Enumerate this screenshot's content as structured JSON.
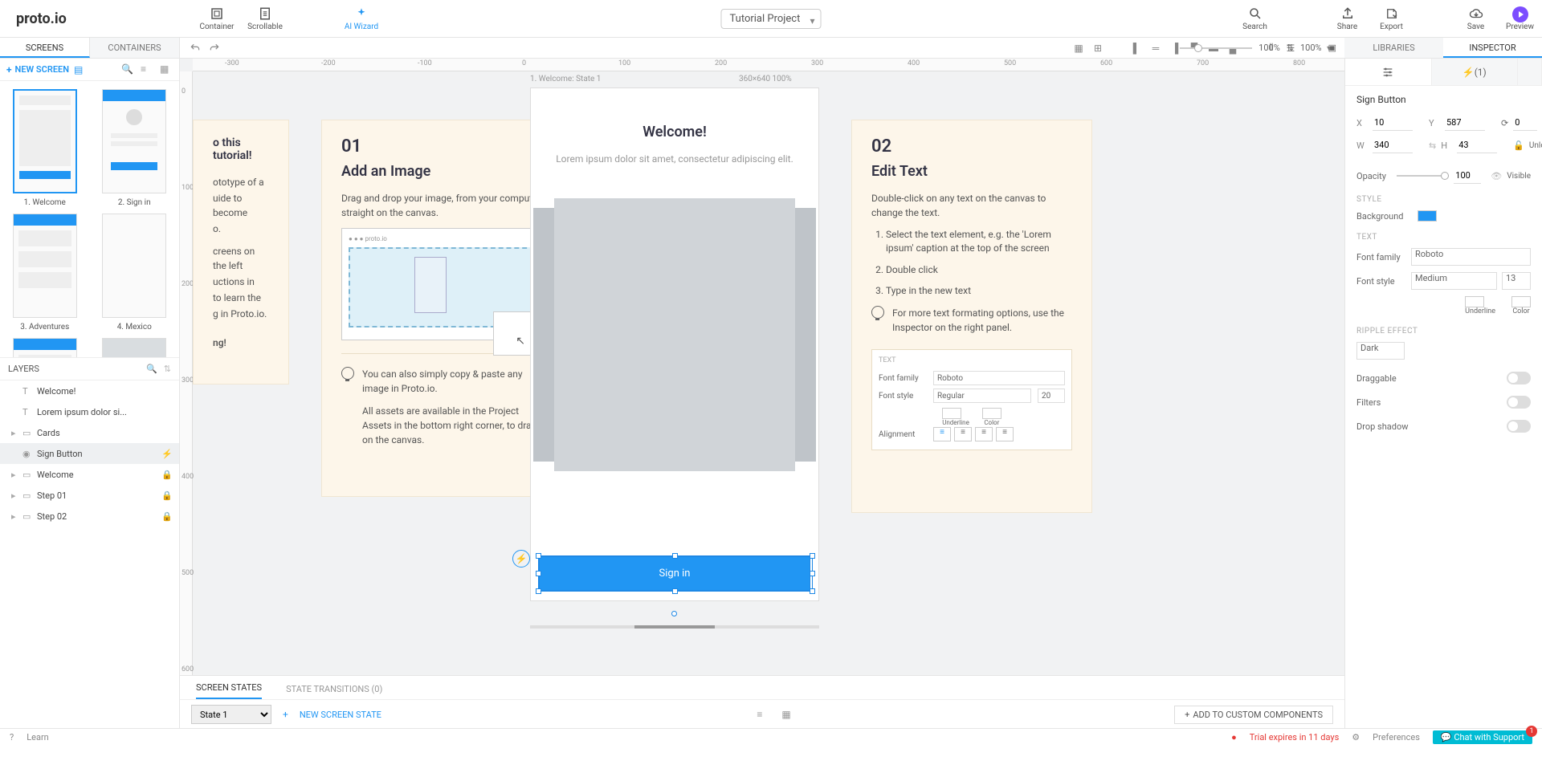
{
  "logo": "proto.io",
  "toolbar": {
    "container": "Container",
    "scrollable": "Scrollable",
    "ai": "AI Wizard",
    "search": "Search",
    "share": "Share",
    "export": "Export",
    "save": "Save",
    "preview": "Preview"
  },
  "project_title": "Tutorial Project",
  "left_tabs": {
    "screens": "SCREENS",
    "containers": "CONTAINERS"
  },
  "new_screen": "NEW SCREEN",
  "screens": [
    {
      "label": "1. Welcome"
    },
    {
      "label": "2. Sign in"
    },
    {
      "label": "3. Adventures"
    },
    {
      "label": "4. Mexico"
    },
    {
      "label": ""
    },
    {
      "label": ""
    }
  ],
  "layers_head": "LAYERS",
  "layers": [
    {
      "name": "Welcome!",
      "type": "text"
    },
    {
      "name": "Lorem ipsum dolor si...",
      "type": "text"
    },
    {
      "name": "Cards",
      "type": "group"
    },
    {
      "name": "Sign Button",
      "type": "comp",
      "selected": true
    },
    {
      "name": "Welcome",
      "type": "group",
      "locked": true
    },
    {
      "name": "Step 01",
      "type": "group",
      "locked": true
    },
    {
      "name": "Step 02",
      "type": "group",
      "locked": true
    }
  ],
  "right_tabs": {
    "libraries": "LIBRARIES",
    "inspector": "INSPECTOR"
  },
  "zoom": {
    "v1": "100%",
    "v2": "100%"
  },
  "canvas": {
    "phone_label": "1. Welcome: State 1",
    "phone_meta": "360×640   100%",
    "welcome_title": "Welcome!",
    "welcome_sub": "Lorem ipsum dolor sit amet, consectetur adipiscing elit.",
    "sign_label": "Sign in",
    "card0": {
      "partial1": "o this tutorial!",
      "partial2": "ototype of a",
      "partial3": "uide to become",
      "partial4": "o.",
      "partial5": "creens on the left",
      "partial6": "uctions in",
      "partial7": "to learn the",
      "partial8": "g in Proto.io.",
      "partial9": "ng!"
    },
    "card1": {
      "num": "01",
      "title": "Add an Image",
      "p1": "Drag and drop your image, from your computer straight on the canvas.",
      "tip1": "You can also simply copy & paste any image in Proto.io.",
      "tip2": "All assets are available in the Project Assets in the bottom right corner, to drag on the canvas."
    },
    "card2": {
      "num": "02",
      "title": "Edit Text",
      "p1": "Double-click on any text on the canvas to change the text.",
      "s1": "Select the text element, e.g. the 'Lorem ipsum' caption at the top of the screen",
      "s2": "Double click",
      "s3": "Type in the new text",
      "tip": "For more text formating options, use the Inspector on the right panel.",
      "mini": {
        "head": "TEXT",
        "ff_l": "Font family",
        "ff_v": "Roboto",
        "fs_l": "Font style",
        "fs_v": "Regular",
        "fs_n": "20",
        "u": "Underline",
        "c": "Color",
        "al": "Alignment"
      }
    }
  },
  "ruler_h": [
    "-300",
    "-200",
    "-100",
    "0",
    "100",
    "200",
    "300",
    "400",
    "500",
    "600",
    "700",
    "800"
  ],
  "ruler_v": [
    "0",
    "100",
    "200",
    "300",
    "400",
    "500",
    "600"
  ],
  "states": {
    "tab1": "SCREEN STATES",
    "tab2": "STATE TRANSITIONS (0)",
    "state_sel": "State 1",
    "new_state": "NEW SCREEN STATE",
    "add_cc": "ADD TO CUSTOM COMPONENTS"
  },
  "inspector": {
    "interactions": "(1)",
    "el_name": "Sign Button",
    "x_l": "X",
    "x": "10",
    "y_l": "Y",
    "y": "587",
    "rot_l": "",
    "rot": "0",
    "deg": "°",
    "w_l": "W",
    "w": "340",
    "h_l": "H",
    "h": "43",
    "unlocked": "Unlocked",
    "opacity_l": "Opacity",
    "opacity": "100",
    "visible": "Visible",
    "style": "STYLE",
    "bg_l": "Background",
    "text": "TEXT",
    "ff_l": "Font family",
    "ff": "Roboto",
    "fs_l": "Font style",
    "fs": "Medium",
    "fsize": "13",
    "u": "Underline",
    "c": "Color",
    "ripple": "RIPPLE EFFECT",
    "ripple_v": "Dark",
    "draggable": "Draggable",
    "filters": "Filters",
    "shadow": "Drop shadow"
  },
  "status": {
    "learn": "Learn",
    "trial": "Trial expires in 11 days",
    "prefs": "Preferences",
    "chat": "Chat with Support",
    "chat_badge": "1"
  }
}
